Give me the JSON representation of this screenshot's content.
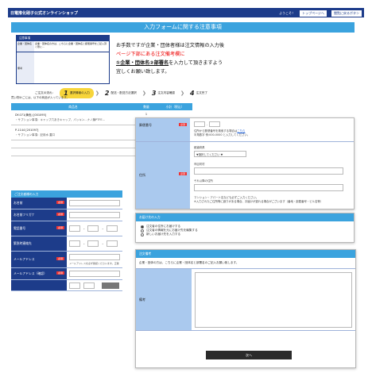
{
  "header": {
    "shop_name": "日電推化硝子公式オンラインショップ",
    "nav": [
      "ようこそ！",
      "トップページへ",
      "閲覧に戻るボタン"
    ]
  },
  "title": "入力フォームに関する注意事項",
  "mini_box": {
    "title": "注意事項",
    "row1_label": "企業・団体名",
    "row1_value": "企業・団体名の方は、こちらに企業・団体名と郵便番号をご記入頂く際に…",
    "row2_label": "備考"
  },
  "notice": {
    "line1": "お手数ですが企業・団体者様は注文情報の入力後",
    "line2": "ページ下部にある注文備考欄に",
    "line3": "①企業・団体名②部署名",
    "line3_tail": "を入力して頂きますよう",
    "line4": "宜しくお願い致します。"
  },
  "steps": {
    "label": "ご注文の流れ：",
    "items": [
      {
        "num": "1",
        "label": "選択情報の入力"
      },
      {
        "num": "2",
        "label": "配送・配送方法選択"
      },
      {
        "num": "3",
        "label": "注文内容確認"
      },
      {
        "num": "4",
        "label": "注文完了"
      }
    ]
  },
  "intro": "買い物かごには、以下の商品が入っています。",
  "cart": {
    "headers": [
      "商品名",
      "数量",
      "小計（税込）"
    ],
    "rows": [
      {
        "name": "DY-071(黄色) [001095]",
        "option": "・サプション事項：キャップ穴あきキャップ、パッキン…ナノ膜PTFE…",
        "qty": "1"
      },
      {
        "name": "P-1144 [201097]",
        "option": "・サプション事項：記用水 蓋口",
        "qty": ""
      }
    ]
  },
  "orderer": {
    "section": "ご注文者様の入力",
    "required": "必須",
    "fields": {
      "name": "お名前",
      "kana": "お名前フリガナ",
      "tel": "電話番号",
      "emergency": "緊急時連絡先",
      "email": "メールアドレス",
      "email_confirm": "メールアドレス（確認）"
    },
    "email_note": "メールアドレスを必ず確認くださいます。正確",
    "dash": "-"
  },
  "address_card": {
    "required": "必須",
    "postal_label": "郵便番号",
    "postal_hint_1": "住所から郵便番号を検索する場合は",
    "postal_hint_link": "こちら",
    "postal_hint_2": "半角数字 例:000-0000 と入力してください。",
    "address_label": "住所",
    "pref_label": "都道府県",
    "pref_select": "▼選択してください ▼",
    "city_label": "市区町村",
    "street_label": "それ以降の住所",
    "address_note_1": "マンション・アパート名なども必ずご入力ください。",
    "address_note_2": "※入力されたご住所等に誤りがある場合、お届けが遅れる場合がございます（番地・部屋番号・ビル名等）"
  },
  "delivery_card": {
    "section": "お届け先の入力",
    "options": [
      {
        "label": "注文者の住所にお届けする",
        "checked": true
      },
      {
        "label": "注文者の情報を元にお届け先を編集する",
        "checked": false
      },
      {
        "label": "新しいお届け先を入力する",
        "checked": false
      }
    ]
  },
  "remarks_card": {
    "section": "注文備考",
    "desc": "企業・団体の方は、こちらに企業・団体名と部署名のご記入お願い致します。",
    "label": "備考",
    "next_button": "次へ"
  },
  "colors": {
    "navy": "#1d3c8a",
    "accent": "#3ba3de",
    "label_blue": "#aac9ee",
    "required_red": "#e33",
    "step_active": "#f7d53a"
  }
}
